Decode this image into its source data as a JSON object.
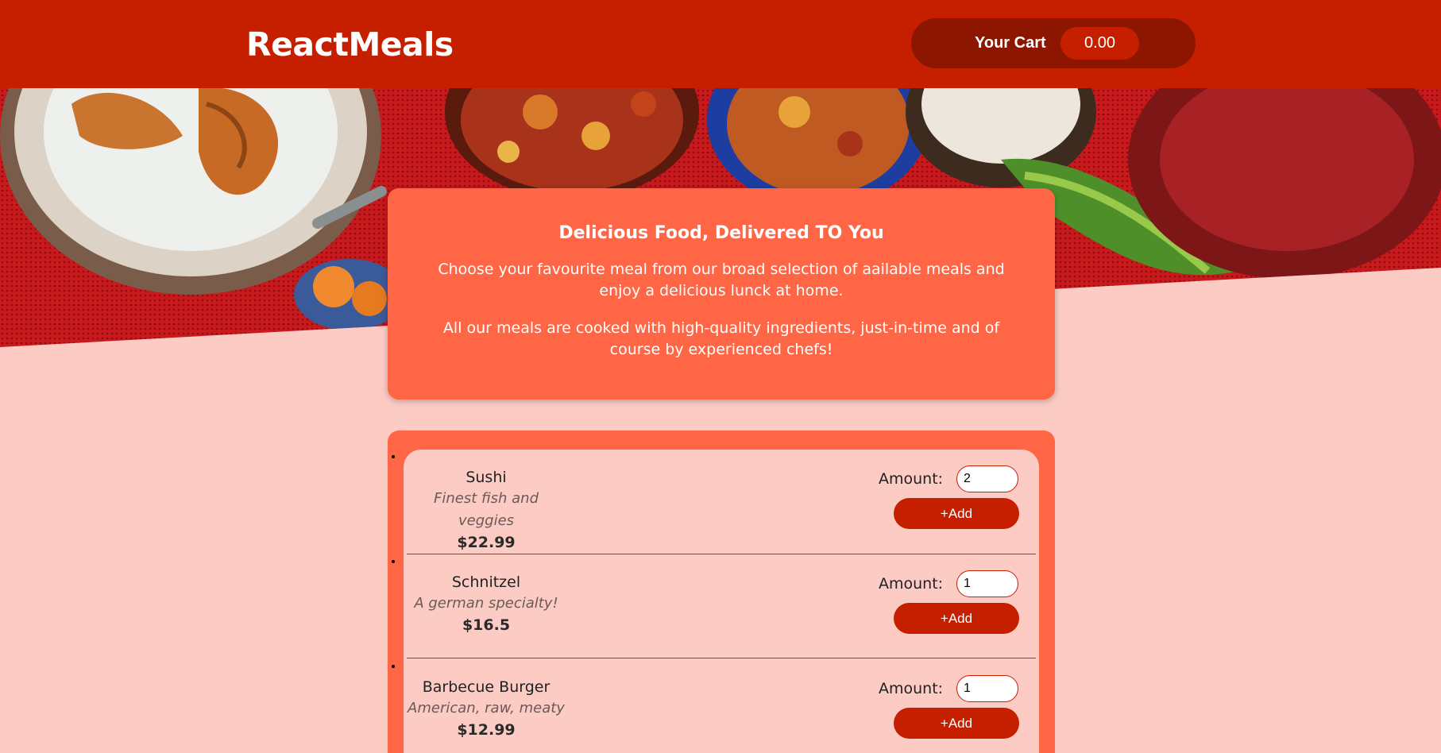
{
  "header": {
    "logo": "ReactMeals",
    "cart_label": "Your Cart",
    "cart_total": "0.00"
  },
  "summary": {
    "title": "Delicious Food, Delivered TO You",
    "paragraph1": "Choose your favourite meal from our broad selection of aailable meals and enjoy a delicious lunck at home.",
    "paragraph2": "All our meals are cooked with high-quality ingredients, just-in-time and of course by experienced chefs!"
  },
  "meals": [
    {
      "name": "Sushi",
      "description": "Finest fish and veggies",
      "price": "$22.99",
      "amount_label": "Amount:",
      "amount": "2",
      "add_label": "+Add"
    },
    {
      "name": "Schnitzel",
      "description": "A german specialty!",
      "price": "$16.5",
      "amount_label": "Amount:",
      "amount": "1",
      "add_label": "+Add"
    },
    {
      "name": "Barbecue Burger",
      "description": "American, raw, meaty",
      "price": "$12.99",
      "amount_label": "Amount:",
      "amount": "1",
      "add_label": "+Add"
    }
  ],
  "colors": {
    "header_red": "#c51f00",
    "cart_button_dark": "#8c1600",
    "card_orange": "#ff6646",
    "page_pink": "#fbcbc4"
  }
}
